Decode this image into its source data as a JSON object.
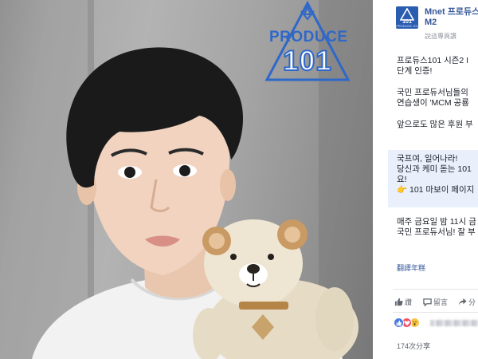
{
  "photo": {
    "logo": {
      "word": "PRODUCE",
      "number": "101"
    }
  },
  "post": {
    "page_name_line1": "Mnet 프로듀스",
    "page_name_line2": "M2",
    "subline": "說這專頁讚",
    "avatar": {
      "number": "101",
      "caption": "PRODUCE 101"
    },
    "body_lines": [
      "프로듀스101 시즌2 I",
      "단계 인증!",
      "국민 프로듀서님들의",
      "연습생이 'MCM 공룡",
      "앞으로도 많은 후원 부",
      "국프여, 일어나라!",
      "당신과 케미 돋는 101",
      "요!",
      "👉 101 마보이 페이지",
      "매주 금요일 밤 11시 금",
      "국민 프로듀서님! 잘 부"
    ],
    "translate_link": "翻譯年糕",
    "actions": [
      {
        "icon": "like-icon",
        "label": "讚"
      },
      {
        "icon": "comment-icon",
        "label": "留言"
      },
      {
        "icon": "share-icon",
        "label": "分"
      }
    ],
    "shares": "174次分享"
  },
  "colors": {
    "brand_blue": "#2f68c9",
    "link_blue": "#365899",
    "highlight_bg": "#e9f0fb"
  }
}
